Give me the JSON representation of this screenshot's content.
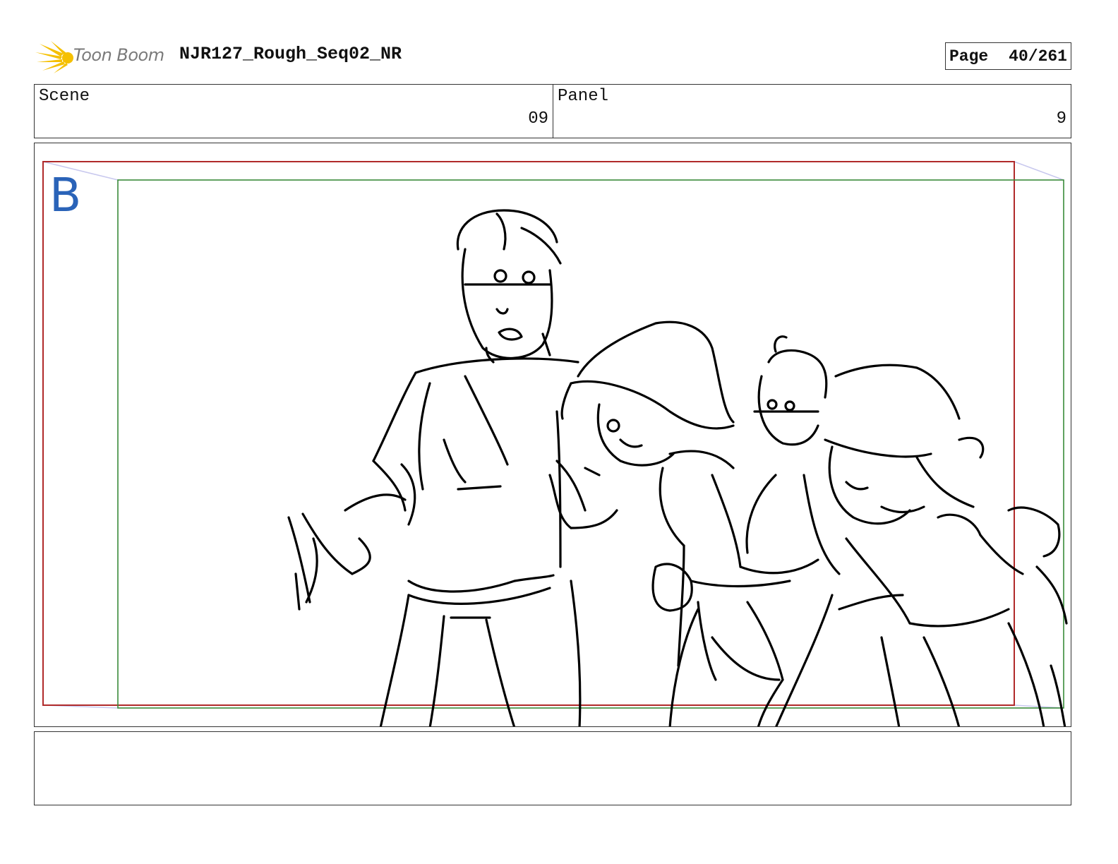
{
  "header": {
    "brand": "Toon Boom",
    "logo_icon": "starburst-logo-icon",
    "logo_color": "#f5c000",
    "document_title": "NJR127_Rough_Seq02_NR",
    "page_label": "Page",
    "page_number": "40/261"
  },
  "info": {
    "scene_label": "Scene",
    "scene_value": "09",
    "panel_label": "Panel",
    "panel_value": "9"
  },
  "panel": {
    "layer_label": "B",
    "layer_label_color": "#2a63b8",
    "frame_colors": {
      "camera_start": "#b02a2a",
      "camera_end": "#3a8a3a",
      "motion_path": "#c8c8ee"
    }
  },
  "notes": {
    "text": ""
  }
}
